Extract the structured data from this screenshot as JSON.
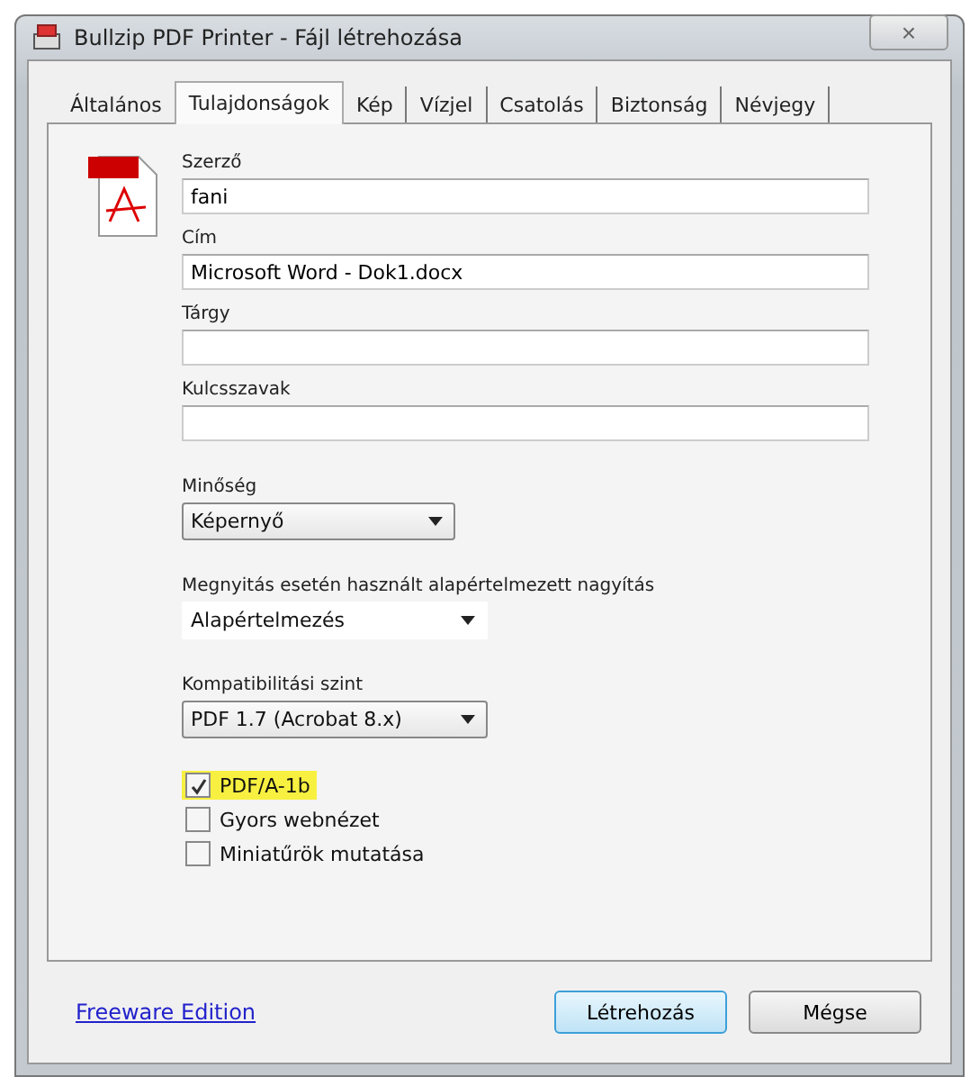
{
  "window": {
    "title": "Bullzip PDF Printer - Fájl létrehozása",
    "close": "×"
  },
  "tabs": [
    {
      "label": "Általános",
      "selected": false
    },
    {
      "label": "Tulajdonságok",
      "selected": true
    },
    {
      "label": "Kép",
      "selected": false
    },
    {
      "label": "Vízjel",
      "selected": false
    },
    {
      "label": "Csatolás",
      "selected": false
    },
    {
      "label": "Biztonság",
      "selected": false
    },
    {
      "label": "Névjegy",
      "selected": false
    }
  ],
  "fields": [
    {
      "label": "Szerző",
      "value": "fani"
    },
    {
      "label": "Cím",
      "value": "Microsoft Word - Dok1.docx"
    },
    {
      "label": "Tárgy"
    },
    {
      "label": "Kulcsszavak"
    }
  ],
  "dropdowns": [
    {
      "label": "Minőség",
      "value": "Képernyő",
      "bordered": true,
      "wide": false
    },
    {
      "label": "Megnyitás esetén használt alapértelmezett nagyítás",
      "value": "Alapértelmezés",
      "bordered": false,
      "wide": true
    },
    {
      "label": "Kompatibilitási szint",
      "value": "PDF 1.7 (Acrobat 8.x)",
      "bordered": true,
      "wide": true
    }
  ],
  "checkboxes": [
    {
      "label": "PDF/A-1b",
      "checked": true,
      "highlighted": true
    },
    {
      "label": "Gyors webnézet",
      "checked": false,
      "highlighted": false
    },
    {
      "label": "Miniatűrök mutatása",
      "checked": false,
      "highlighted": false
    }
  ],
  "footer": {
    "link": "Freeware Edition",
    "buttons": [
      {
        "label": "Létrehozás",
        "default": true
      },
      {
        "label": "Mégse",
        "default": false
      }
    ]
  }
}
